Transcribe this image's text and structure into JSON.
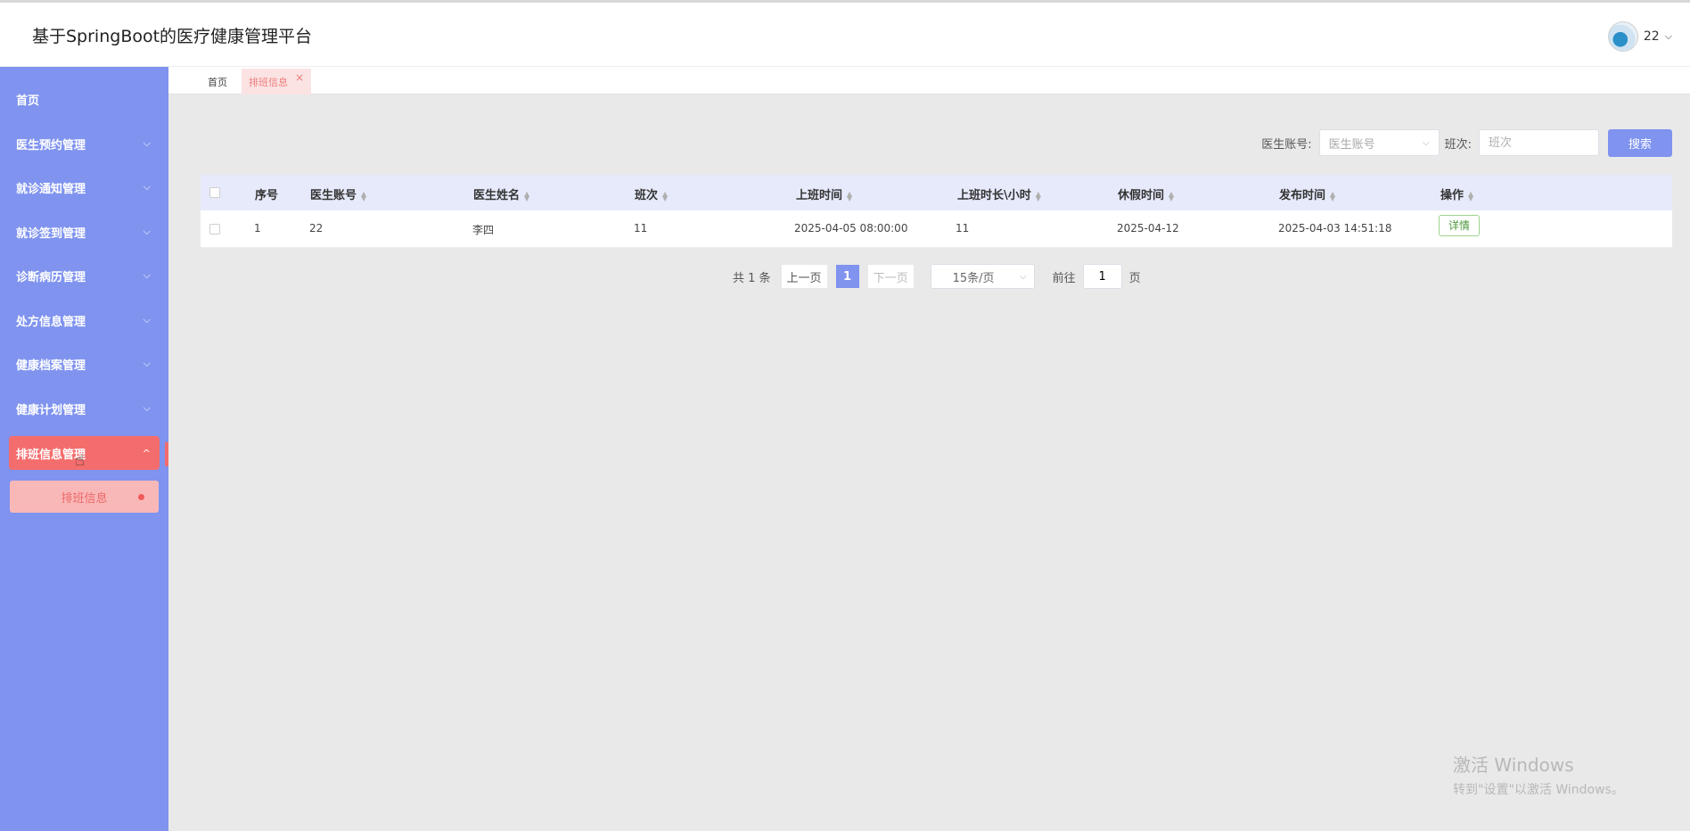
{
  "header": {
    "app_title": "基于SpringBoot的医疗健康管理平台",
    "user_name": "22",
    "caret": "⌵"
  },
  "sidebar": {
    "items": [
      {
        "label": "首页",
        "chevron": ""
      },
      {
        "label": "医生预约管理",
        "chevron": "⌵"
      },
      {
        "label": "就诊通知管理",
        "chevron": "⌵"
      },
      {
        "label": "就诊签到管理",
        "chevron": "⌵"
      },
      {
        "label": "诊断病历管理",
        "chevron": "⌵"
      },
      {
        "label": "处方信息管理",
        "chevron": "⌵"
      },
      {
        "label": "健康档案管理",
        "chevron": "⌵"
      },
      {
        "label": "健康计划管理",
        "chevron": "⌵"
      },
      {
        "label": "排班信息管理",
        "chevron": "^"
      }
    ],
    "submenu": {
      "label": "排班信息"
    }
  },
  "tabs": {
    "home": "首页",
    "active": "排班信息",
    "close": "×"
  },
  "search": {
    "doctor_account_label": "医生账号:",
    "doctor_account_placeholder": "医生账号",
    "shift_label": "班次:",
    "shift_placeholder": "班次",
    "button": "搜索"
  },
  "table": {
    "columns": [
      "序号",
      "医生账号",
      "医生姓名",
      "班次",
      "上班时间",
      "上班时长\\小时",
      "休假时间",
      "发布时间",
      "操作"
    ],
    "rows": [
      {
        "index": "1",
        "doctor_account": "22",
        "doctor_name": "李四",
        "shift": "11",
        "start_time": "2025-04-05 08:00:00",
        "hours": "11",
        "leave_time": "2025-04-12",
        "publish_time": "2025-04-03 14:51:18",
        "action": "详情"
      }
    ]
  },
  "pagination": {
    "total": "共 1 条",
    "prev": "上一页",
    "current": "1",
    "next": "下一页",
    "page_size": "15条/页",
    "goto_label": "前往",
    "goto_value": "1",
    "page_suffix": "页"
  },
  "watermark": {
    "title": "激活 Windows",
    "subtitle": "转到\"设置\"以激活 Windows。"
  },
  "colors": {
    "sidebar": "#7f93ef",
    "active_menu": "#f46d6d",
    "submenu_bg": "#f9b8b8",
    "table_header": "#e6eafb"
  }
}
